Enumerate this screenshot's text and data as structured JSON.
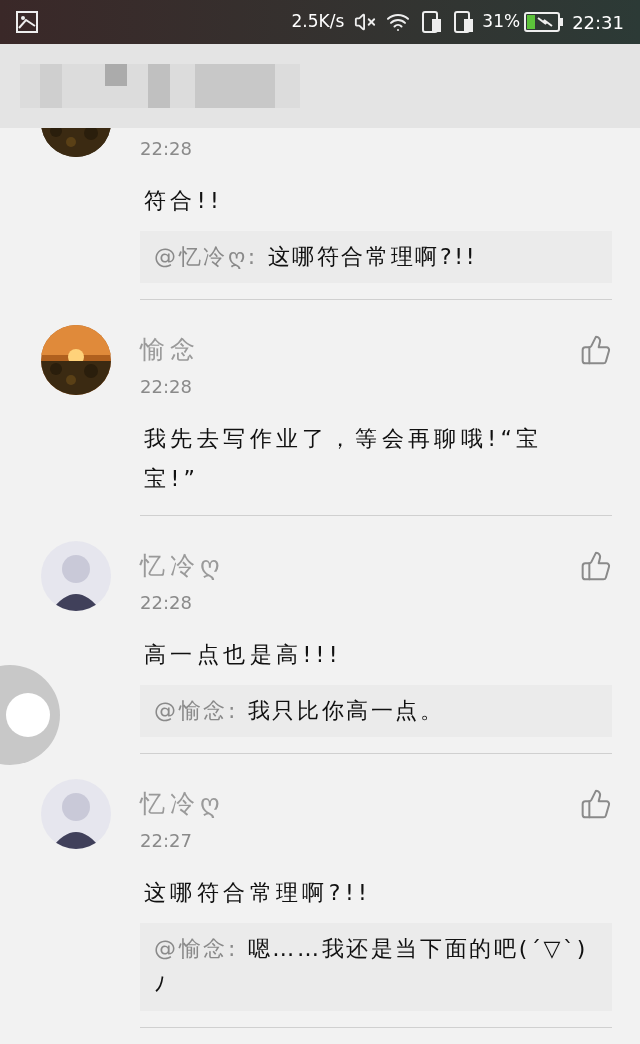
{
  "status_bar": {
    "speed": "2.5K/s",
    "battery": "31%",
    "time": "22:31"
  },
  "comments": [
    {
      "time": "22:28",
      "text": "符合!!",
      "reply": {
        "to": "@忆冷ღ:",
        "text": "这哪符合常理啊?!!"
      }
    },
    {
      "name": "愉念",
      "time": "22:28",
      "text": "我先去写作业了，等会再聊哦!“宝宝!”"
    },
    {
      "name": "忆冷ღ",
      "avatar": {
        "kind": "avatar"
      },
      "time": "22:28",
      "text": "高一点也是高!!!",
      "reply": {
        "to": "@愉念:",
        "text": "我只比你高一点。"
      }
    },
    {
      "name": "忆冷ღ",
      "avatar": {
        "kind": "avatar"
      },
      "time": "22:27",
      "text": "这哪符合常理啊?!!",
      "reply": {
        "to": "@愉念:",
        "text": "嗯……我还是当下面的吧(´▽`)ﾉ"
      }
    }
  ]
}
